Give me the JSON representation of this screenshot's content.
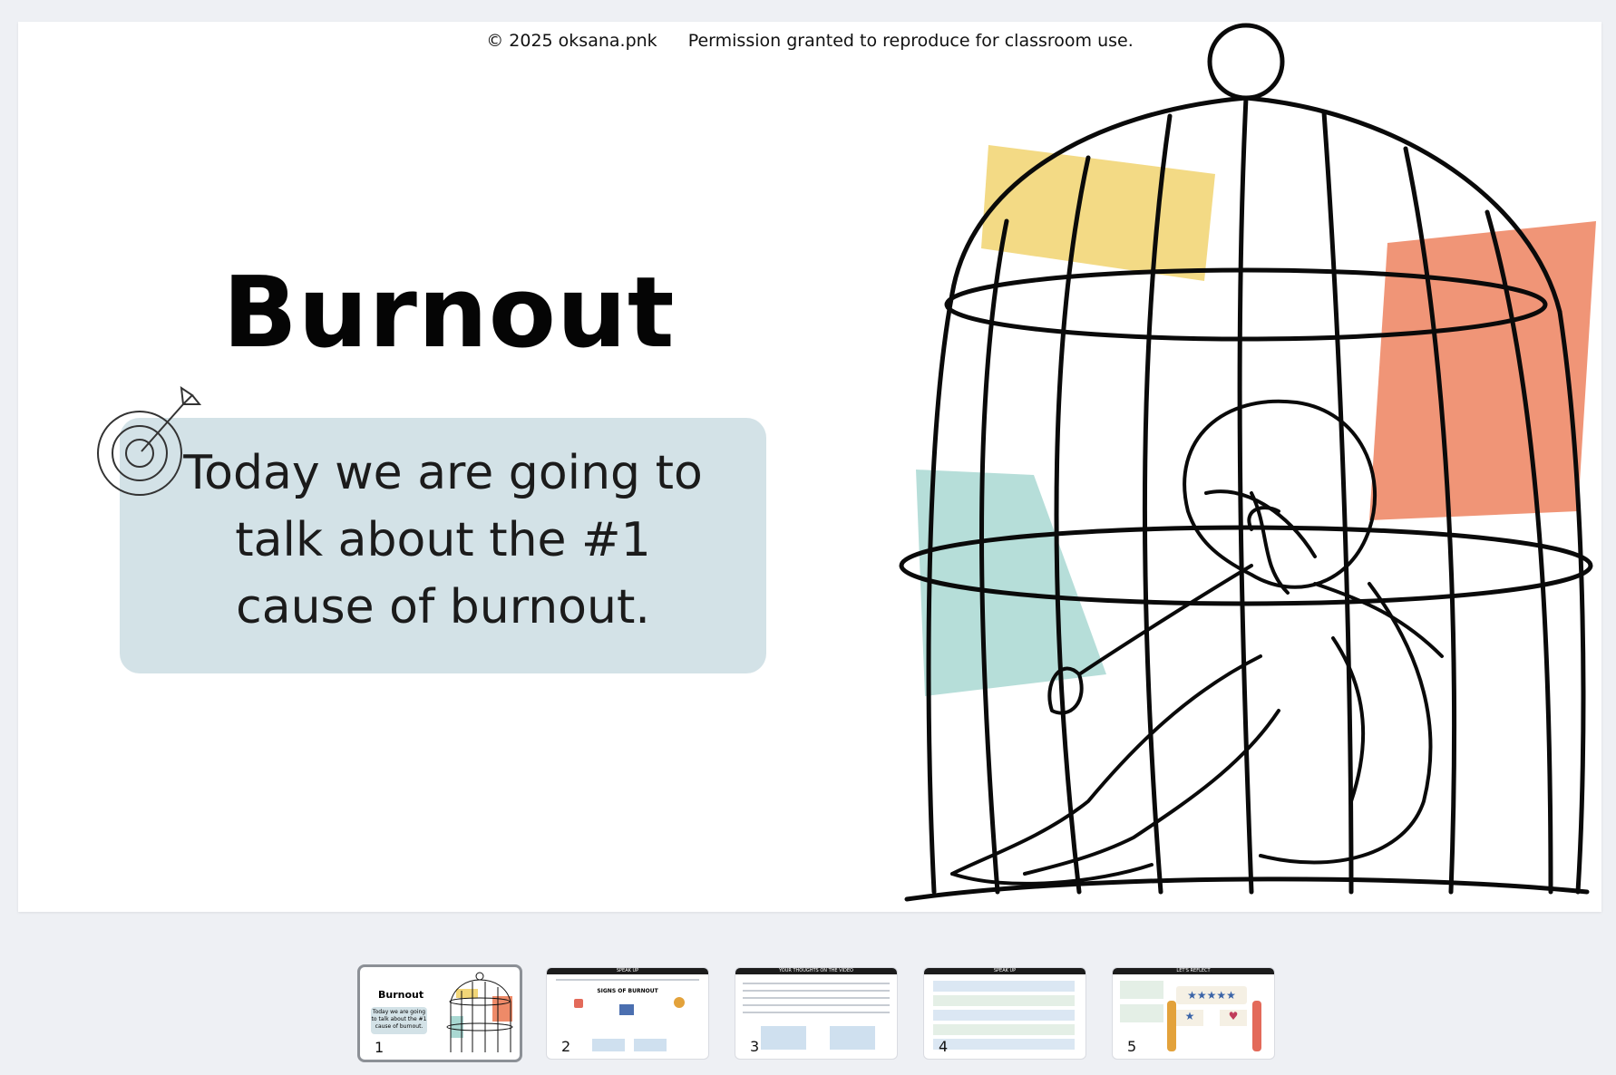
{
  "slide": {
    "copyright": "© 2025 oksana.pnk",
    "permission": "Permission granted to reproduce for classroom use.",
    "title": "Burnout",
    "goal_lines": [
      "Today we are going to",
      "talk about the #1",
      "cause of burnout."
    ],
    "icons": {
      "goal": "target-arrow-icon",
      "illustration": "caged-sad-girl-illustration"
    },
    "colors": {
      "goal_box": "#d3e2e7",
      "yellow_patch": "#f2d678",
      "orange_patch": "#ee8a68",
      "teal_patch": "#a9d8d2"
    }
  },
  "thumbnails": [
    {
      "number": "1",
      "active": true,
      "title": "Burnout",
      "text": "Today we are going to talk about the #1 cause of burnout."
    },
    {
      "number": "2",
      "active": false,
      "header": "SPEAK UP",
      "title": "SIGNS OF BURNOUT"
    },
    {
      "number": "3",
      "active": false,
      "header": "YOUR THOUGHTS ON THE VIDEO"
    },
    {
      "number": "4",
      "active": false,
      "header": "SPEAK UP"
    },
    {
      "number": "5",
      "active": false,
      "header": "LET'S REFLECT"
    }
  ]
}
